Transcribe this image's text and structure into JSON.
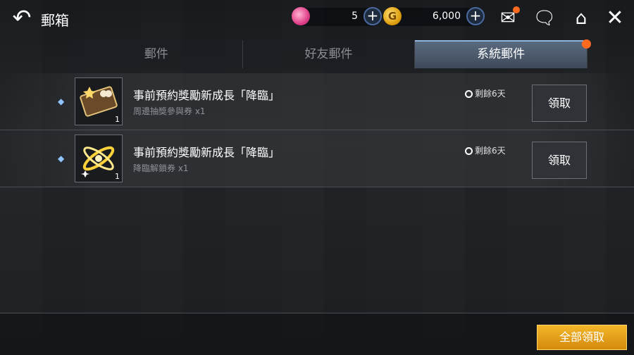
{
  "header": {
    "title": "郵箱",
    "gems": "5",
    "gold": "6,000"
  },
  "tabs": [
    {
      "label": "郵件",
      "active": false
    },
    {
      "label": "好友郵件",
      "active": false
    },
    {
      "label": "系統郵件",
      "active": true
    }
  ],
  "mails": [
    {
      "title": "事前預約獎勵新成長「降臨」",
      "item": "周邊抽獎參與券 x1",
      "qty": "1",
      "remaining": "剩餘6天",
      "claim_label": "領取",
      "icon": "ticket-icon"
    },
    {
      "title": "事前預約獎勵新成長「降臨」",
      "item": "降臨解鎖券 x1",
      "qty": "1",
      "remaining": "剩餘6天",
      "claim_label": "領取",
      "icon": "golden-ring-icon"
    }
  ],
  "footer": {
    "claim_all_label": "全部領取"
  },
  "colors": {
    "accent": "#8fb4e0",
    "claim_all": "#e9a11a",
    "notification": "#ff6a1f"
  }
}
